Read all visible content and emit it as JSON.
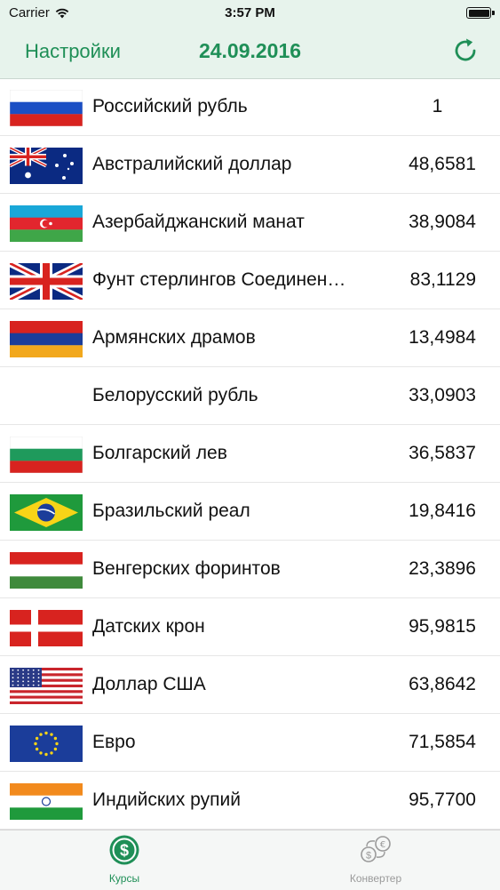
{
  "status_bar": {
    "carrier": "Carrier",
    "time": "3:57 PM"
  },
  "nav": {
    "settings_label": "Настройки",
    "date": "24.09.2016",
    "refresh_icon": "refresh-icon"
  },
  "currencies": [
    {
      "flag": "russia",
      "name": "Российский рубль",
      "rate": "1"
    },
    {
      "flag": "australia",
      "name": "Австралийский доллар",
      "rate": "48,6581"
    },
    {
      "flag": "azerbaijan",
      "name": "Азербайджанский манат",
      "rate": "38,9084"
    },
    {
      "flag": "united-kingdom",
      "name": "Фунт стерлингов Соединен…",
      "rate": "83,1129"
    },
    {
      "flag": "armenia",
      "name": "Армянских драмов",
      "rate": "13,4984"
    },
    {
      "flag": "none",
      "name": "Белорусский рубль",
      "rate": "33,0903"
    },
    {
      "flag": "bulgaria",
      "name": "Болгарский лев",
      "rate": "36,5837"
    },
    {
      "flag": "brazil",
      "name": "Бразильский реал",
      "rate": "19,8416"
    },
    {
      "flag": "hungary",
      "name": "Венгерских форинтов",
      "rate": "23,3896"
    },
    {
      "flag": "denmark",
      "name": "Датских крон",
      "rate": "95,9815"
    },
    {
      "flag": "usa",
      "name": "Доллар США",
      "rate": "63,8642"
    },
    {
      "flag": "eu",
      "name": "Евро",
      "rate": "71,5854"
    },
    {
      "flag": "india",
      "name": "Индийских рупий",
      "rate": "95,7700"
    }
  ],
  "tabs": [
    {
      "label": "Курсы",
      "icon": "dollar-coin-icon",
      "active": true
    },
    {
      "label": "Конвертер",
      "icon": "currency-exchange-icon",
      "active": false
    }
  ],
  "colors": {
    "accent": "#1f8f57",
    "nav_background": "#e7f3ec",
    "inactive_tab": "#9a9a9a"
  }
}
